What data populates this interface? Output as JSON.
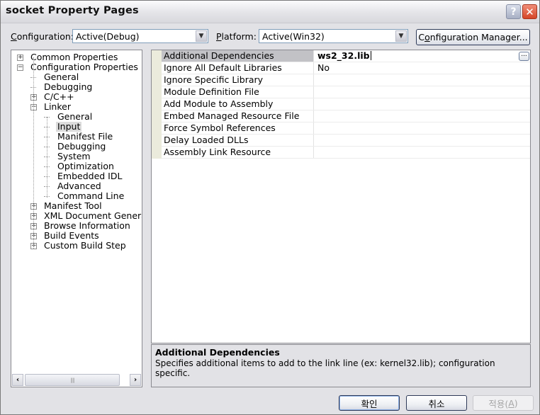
{
  "window": {
    "title": "socket Property Pages",
    "help_glyph": "?",
    "close_glyph": "✕"
  },
  "toolbar": {
    "configuration_label_accel": "C",
    "configuration_label_rest": "onfiguration:",
    "configuration_value": "Active(Debug)",
    "platform_label_accel": "P",
    "platform_label_rest": "latform:",
    "platform_value": "Active(Win32)",
    "config_manager_pre": "C",
    "config_manager_accel": "o",
    "config_manager_rest": "nfiguration Manager...",
    "dropdown_glyph": "▼"
  },
  "tree": {
    "items": [
      {
        "label": "Common Properties",
        "level": 0,
        "expander": "+"
      },
      {
        "label": "Configuration Properties",
        "level": 0,
        "expander": "−"
      },
      {
        "label": "General",
        "level": 1
      },
      {
        "label": "Debugging",
        "level": 1
      },
      {
        "label": "C/C++",
        "level": 1,
        "expander": "+"
      },
      {
        "label": "Linker",
        "level": 1,
        "expander": "−"
      },
      {
        "label": "General",
        "level": 2
      },
      {
        "label": "Input",
        "level": 2,
        "selected": true
      },
      {
        "label": "Manifest File",
        "level": 2
      },
      {
        "label": "Debugging",
        "level": 2
      },
      {
        "label": "System",
        "level": 2
      },
      {
        "label": "Optimization",
        "level": 2
      },
      {
        "label": "Embedded IDL",
        "level": 2
      },
      {
        "label": "Advanced",
        "level": 2
      },
      {
        "label": "Command Line",
        "level": 2
      },
      {
        "label": "Manifest Tool",
        "level": 1,
        "expander": "+"
      },
      {
        "label": "XML Document Generator",
        "level": 1,
        "expander": "+"
      },
      {
        "label": "Browse Information",
        "level": 1,
        "expander": "+"
      },
      {
        "label": "Build Events",
        "level": 1,
        "expander": "+"
      },
      {
        "label": "Custom Build Step",
        "level": 1,
        "expander": "+"
      }
    ],
    "scroll_left_glyph": "‹",
    "scroll_right_glyph": "›",
    "thumb_grip": "||||"
  },
  "properties": {
    "rows": [
      {
        "name": "Additional Dependencies",
        "value": "ws2_32.lib",
        "selected": true
      },
      {
        "name": "Ignore All Default Libraries",
        "value": "No"
      },
      {
        "name": "Ignore Specific Library",
        "value": ""
      },
      {
        "name": "Module Definition File",
        "value": ""
      },
      {
        "name": "Add Module to Assembly",
        "value": ""
      },
      {
        "name": "Embed Managed Resource File",
        "value": ""
      },
      {
        "name": "Force Symbol References",
        "value": ""
      },
      {
        "name": "Delay Loaded DLLs",
        "value": ""
      },
      {
        "name": "Assembly Link Resource",
        "value": ""
      }
    ],
    "ellipsis_label": "..."
  },
  "description": {
    "heading": "Additional Dependencies",
    "text": "Specifies additional items to add to the link line (ex: kernel32.lib); configuration specific."
  },
  "buttons": {
    "ok": "확인",
    "cancel": "취소",
    "apply_pre": "적용(",
    "apply_accel": "A",
    "apply_post": ")"
  }
}
